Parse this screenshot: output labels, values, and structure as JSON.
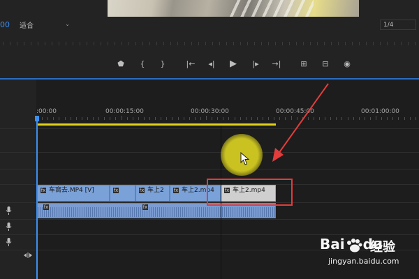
{
  "monitor": {
    "timecode": "00",
    "fit_value": "适合",
    "ratio_value": "1/4"
  },
  "transport": {
    "buttons": [
      {
        "name": "add-marker-button",
        "glyph": "⬟"
      },
      {
        "name": "mark-in-button",
        "glyph": "{"
      },
      {
        "name": "mark-out-button",
        "glyph": "}"
      },
      {
        "name": "go-to-in-button",
        "glyph": "|←"
      },
      {
        "name": "step-back-button",
        "glyph": "◂|"
      },
      {
        "name": "play-button",
        "glyph": "▶"
      },
      {
        "name": "step-forward-button",
        "glyph": "|▸"
      },
      {
        "name": "go-to-out-button",
        "glyph": "→|"
      },
      {
        "name": "lift-button",
        "glyph": "⊞"
      },
      {
        "name": "extract-button",
        "glyph": "⊟"
      },
      {
        "name": "export-frame-button",
        "glyph": "◉"
      }
    ]
  },
  "timeline": {
    "ruler_labels": [
      ":00:00",
      "00:00:15:00",
      "00:00:30:00",
      "00:00:45:00",
      "00:01:00:00"
    ],
    "clips": [
      {
        "name": "clip-1",
        "label": "车窩去.MP4 [V]"
      },
      {
        "name": "clip-2",
        "label": ""
      },
      {
        "name": "clip-3",
        "label": "车上2"
      },
      {
        "name": "clip-4",
        "label": "车上2.mp4"
      },
      {
        "name": "clip-5",
        "label": "车上2.mp4"
      }
    ],
    "fx_label": "fx"
  },
  "watermark": {
    "brand": "Bai",
    "brand_suffix": "du",
    "title": "经验",
    "url": "jingyan.baidu.com"
  },
  "colors": {
    "accent": "#3b8ff0",
    "workarea": "#e3d21c",
    "clip": "#7aa1d8",
    "annotation": "#e43b3b"
  }
}
